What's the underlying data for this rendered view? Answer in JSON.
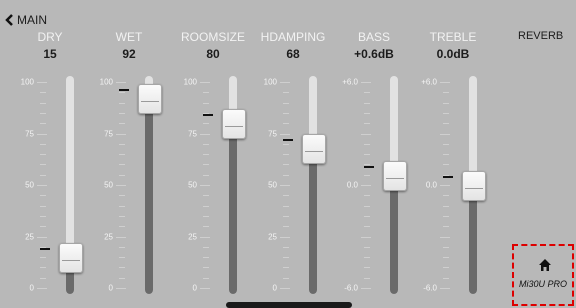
{
  "nav": {
    "back_label": "MAIN"
  },
  "page_title": "REVERB",
  "channels": [
    {
      "name": "DRY",
      "value": "15",
      "level": 0.15,
      "scale": [
        "100",
        "75",
        "50",
        "25",
        "0"
      ]
    },
    {
      "name": "WET",
      "value": "92",
      "level": 0.92,
      "scale": [
        "100",
        "75",
        "50",
        "25",
        "0"
      ]
    },
    {
      "name": "ROOMSIZE",
      "value": "80",
      "level": 0.8,
      "scale": [
        "100",
        "75",
        "50",
        "25",
        "0"
      ]
    },
    {
      "name": "HDAMPING",
      "value": "68",
      "level": 0.68,
      "scale": [
        "100",
        "75",
        "50",
        "25",
        "0"
      ]
    },
    {
      "name": "BASS",
      "value": "+0.6dB",
      "level": 0.55,
      "scale": [
        "+6.0",
        "",
        "0.0",
        "",
        "-6.0"
      ]
    },
    {
      "name": "TREBLE",
      "value": "0.0dB",
      "level": 0.5,
      "scale": [
        "+6.0",
        "",
        "0.0",
        "",
        "-6.0"
      ]
    }
  ],
  "device": {
    "icon": "home-icon",
    "label": "Mi30U PRO"
  },
  "colors": {
    "background": "#b8b8b8",
    "highlight": "#dd0000"
  }
}
